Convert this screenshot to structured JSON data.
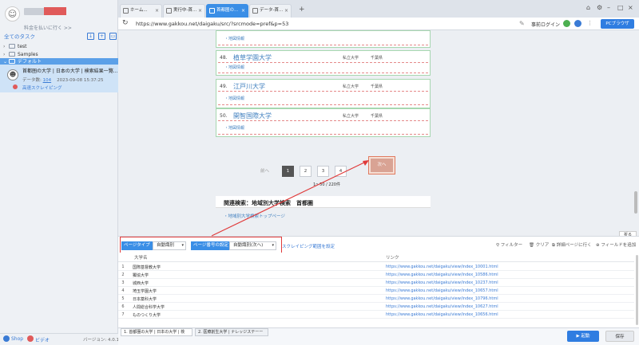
{
  "left_panel": {
    "plan_text": "料金を払いに行く >>",
    "section_title": "全てのタスク",
    "tree": [
      {
        "label": "test"
      },
      {
        "label": "Samples"
      },
      {
        "label": "デフォルト"
      }
    ],
    "task": {
      "title": "首都圏の大学 | 日本の大学 | 検索結果一覧...",
      "meta_label": "データ数:",
      "meta_count": "104",
      "meta_time": "2023-09-08 15:37:25",
      "status": "高速スクレイピング"
    },
    "footer": {
      "shop": "Shop",
      "video": "ビデオ",
      "version": "バージョン: 4.0.1"
    }
  },
  "tabs": [
    {
      "label": "ホーム..."
    },
    {
      "label": "実行中-首..."
    },
    {
      "label": "首都圏の..."
    },
    {
      "label": "データ-首..."
    }
  ],
  "address": {
    "url": "https://www.gakkou.net/daigaku/src/?srcmode=pref&p=53",
    "pre_login": "事前ログイン",
    "browser_button": "PCブラウザ"
  },
  "content": {
    "map_info": "・地図情報",
    "cards": [
      {
        "num": "48.",
        "name": "植草学園大学",
        "type": "私立大学",
        "pref": "千葉県"
      },
      {
        "num": "49.",
        "name": "江戸川大学",
        "type": "私立大学",
        "pref": "千葉県"
      },
      {
        "num": "50.",
        "name": "開智国際大学",
        "type": "私立大学",
        "pref": "千葉県"
      }
    ],
    "pagination": {
      "prev": "前へ",
      "pages": [
        "1",
        "2",
        "3",
        "4"
      ],
      "next": "次へ",
      "count": "1～50 / 220件"
    },
    "related_title": "関連検索：地域別大学検索　首都圏",
    "related_link": "・地域別大学検索トップページ"
  },
  "bottom": {
    "collapse": "折る",
    "page_type_label": "ページタイプ",
    "page_type_value": "自動識別",
    "page_num_label": "ページ番号の設定",
    "page_num_value": "自動識別(次へ)",
    "scroll_setting": "スクレイピング範囲を設定",
    "tools": {
      "filter": "フィルター",
      "clear": "クリア",
      "go_detail": "詳細ページに行く",
      "add_field": "フィールドを追加"
    },
    "columns": [
      "大学名",
      "リンク"
    ],
    "rows": [
      {
        "n": "1",
        "name": "国際基督教大学",
        "link": "https://www.gakkou.net/daigaku/view/index_10001.html"
      },
      {
        "n": "2",
        "name": "獨協大学",
        "link": "https://www.gakkou.net/daigaku/view/index_10586.html"
      },
      {
        "n": "3",
        "name": "城西大学",
        "link": "https://www.gakkou.net/daigaku/view/index_10237.html"
      },
      {
        "n": "4",
        "name": "埼玉学園大学",
        "link": "https://www.gakkou.net/daigaku/view/index_10657.html"
      },
      {
        "n": "5",
        "name": "日本薬科大学",
        "link": "https://www.gakkou.net/daigaku/view/index_10796.html"
      },
      {
        "n": "6",
        "name": "人間総合科学大学",
        "link": "https://www.gakkou.net/daigaku/view/index_10627.html"
      },
      {
        "n": "7",
        "name": "ものつくり大学",
        "link": "https://www.gakkou.net/daigaku/view/index_10656.html"
      }
    ]
  },
  "footer": {
    "tab1": "1. 首都圏の大学 | 日本の大学 | 検",
    "tab2": "2. 医療創生大学 | ナレッジステーー",
    "run": "▶ 起動",
    "save": "保存"
  },
  "colors": {
    "accent": "#3a8ee6",
    "highlight_red": "#e03a3a",
    "next_button": "#d9a394"
  }
}
